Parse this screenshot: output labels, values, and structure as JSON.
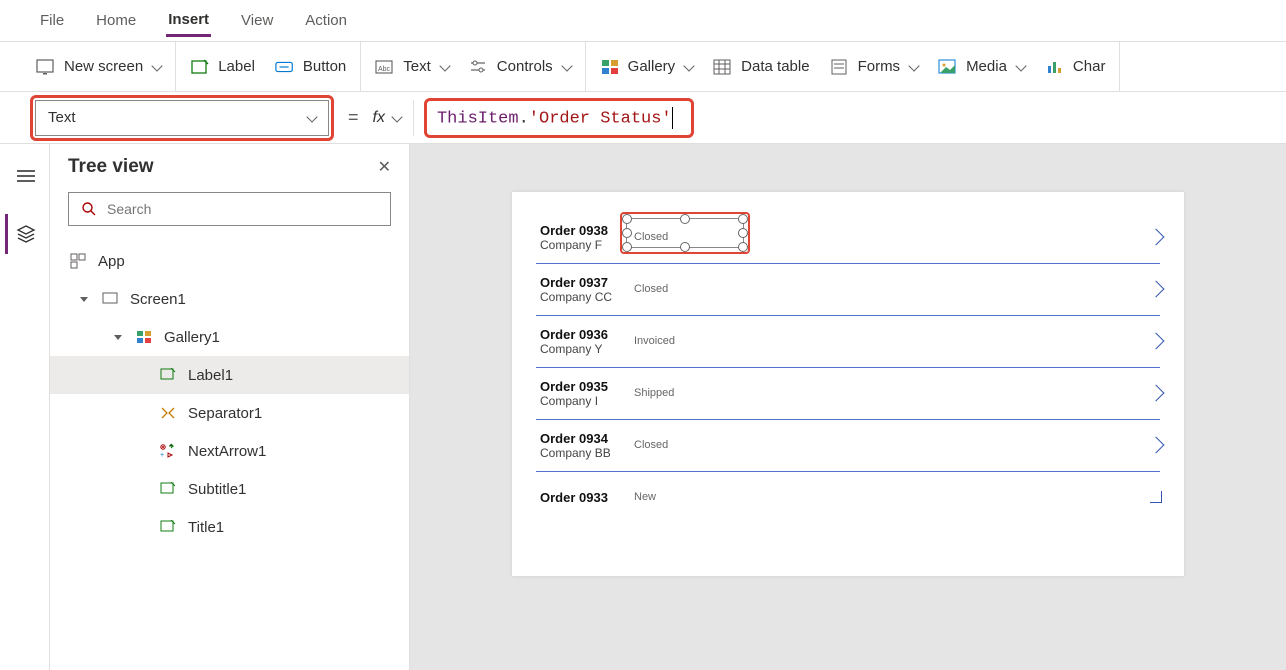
{
  "menubar": {
    "file": "File",
    "home": "Home",
    "insert": "Insert",
    "view": "View",
    "action": "Action"
  },
  "ribbon": {
    "new_screen": "New screen",
    "label": "Label",
    "button": "Button",
    "text": "Text",
    "controls": "Controls",
    "gallery": "Gallery",
    "data_table": "Data table",
    "forms": "Forms",
    "media": "Media",
    "chart": "Char"
  },
  "formula": {
    "property": "Text",
    "fx": "fx",
    "this_item": "ThisItem",
    "dot": ".",
    "value": "'Order Status'"
  },
  "tree": {
    "title": "Tree view",
    "search_placeholder": "Search",
    "app": "App",
    "screen1": "Screen1",
    "gallery1": "Gallery1",
    "label1": "Label1",
    "separator1": "Separator1",
    "nextarrow1": "NextArrow1",
    "subtitle1": "Subtitle1",
    "title1": "Title1"
  },
  "gallery_data": [
    {
      "title": "Order 0938",
      "subtitle": "Company F",
      "status": "Closed"
    },
    {
      "title": "Order 0937",
      "subtitle": "Company CC",
      "status": "Closed"
    },
    {
      "title": "Order 0936",
      "subtitle": "Company Y",
      "status": "Invoiced"
    },
    {
      "title": "Order 0935",
      "subtitle": "Company I",
      "status": "Shipped"
    },
    {
      "title": "Order 0934",
      "subtitle": "Company BB",
      "status": "Closed"
    },
    {
      "title": "Order 0933",
      "subtitle": "",
      "status": "New"
    }
  ]
}
